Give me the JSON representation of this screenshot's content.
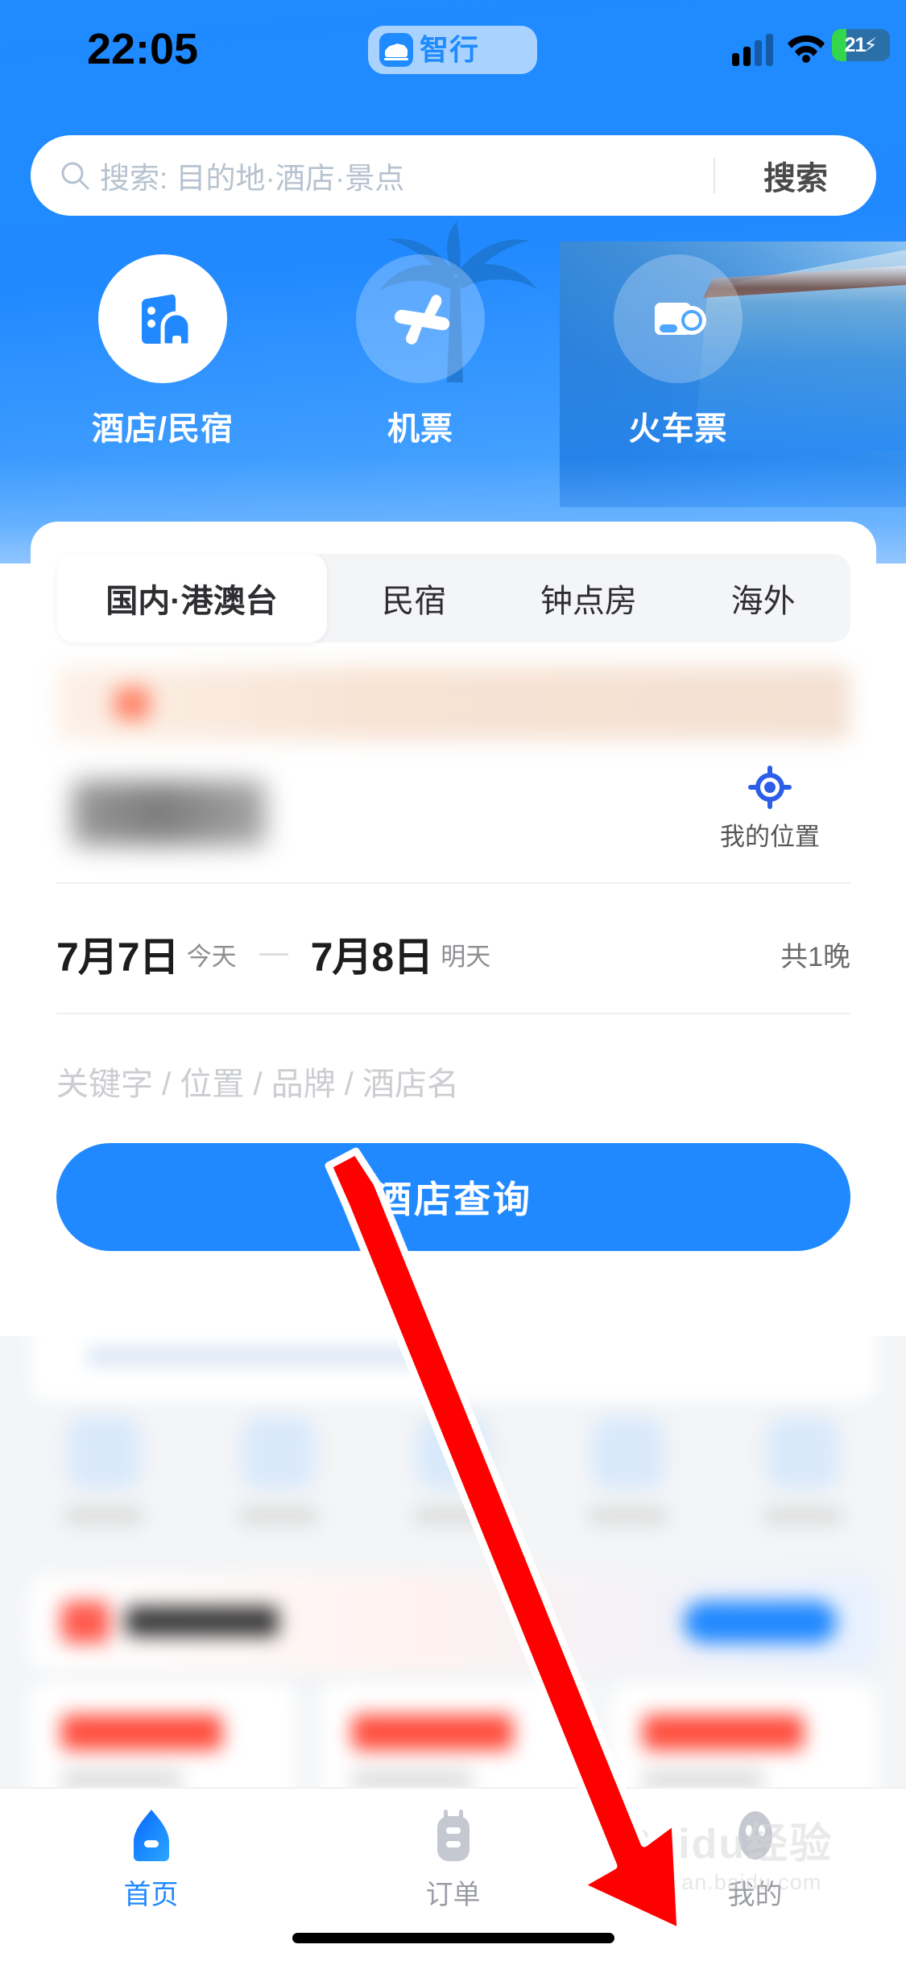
{
  "status_bar": {
    "time": "22:05",
    "dynamic_island_app": "智行",
    "battery_level": "21",
    "battery_charging_icon": "bolt-icon",
    "signal_icon": "cellular-signal-icon",
    "wifi_icon": "wifi-icon"
  },
  "search": {
    "icon": "search-icon",
    "placeholder": "搜索: 目的地·酒店·景点",
    "button_label": "搜索"
  },
  "services": [
    {
      "label": "酒店/民宿",
      "icon": "hotel-icon",
      "active": true
    },
    {
      "label": "机票",
      "icon": "airplane-icon",
      "active": false
    },
    {
      "label": "火车票",
      "icon": "train-ticket-icon",
      "active": false
    }
  ],
  "card": {
    "tabs": [
      {
        "label": "国内·港澳台",
        "active": true
      },
      {
        "label": "民宿",
        "active": false
      },
      {
        "label": "钟点房",
        "active": false
      },
      {
        "label": "海外",
        "active": false
      }
    ],
    "city_value": "",
    "my_location": {
      "label": "我的位置",
      "icon": "locate-crosshair-icon"
    },
    "dates": {
      "checkin_date": "7月7日",
      "checkin_sub": "今天",
      "checkout_date": "7月8日",
      "checkout_sub": "明天",
      "nights": "共1晚"
    },
    "keyword_placeholder": "关键字 / 位置 / 品牌 / 酒店名",
    "query_button": "酒店查询"
  },
  "tabbar": [
    {
      "label": "首页",
      "icon": "home-icon",
      "active": true
    },
    {
      "label": "订单",
      "icon": "orders-icon",
      "active": false
    },
    {
      "label": "我的",
      "icon": "profile-icon",
      "active": false
    }
  ],
  "watermark": {
    "title": "Baidu经验",
    "url": "jingyan.baidu.com"
  },
  "colors": {
    "brand_blue": "#2189ff",
    "annotation_red": "#ff0000",
    "inactive_gray": "#9a9da3",
    "battery_green": "#32d74b"
  }
}
